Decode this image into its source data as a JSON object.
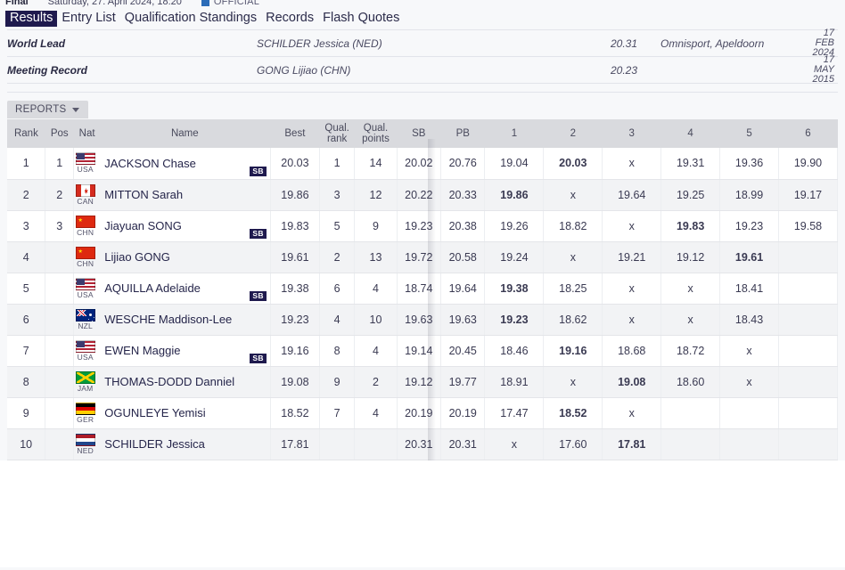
{
  "statusbar": {
    "round": "Final",
    "datetime": "Saturday, 27. April 2024, 18:20",
    "official_label": "OFFICIAL",
    "official_chip_color": "#2b6cb8"
  },
  "tabs": [
    {
      "label": "Results",
      "active": true
    },
    {
      "label": "Entry List",
      "active": false
    },
    {
      "label": "Qualification Standings",
      "active": false
    },
    {
      "label": "Records",
      "active": false
    },
    {
      "label": "Flash Quotes",
      "active": false
    }
  ],
  "records": [
    {
      "label": "World Lead",
      "athlete": "SCHILDER Jessica (NED)",
      "mark": "20.31",
      "venue": "Omnisport, Apeldoorn",
      "date_line1": "17 FEB",
      "date_line2": "2024"
    },
    {
      "label": "Meeting Record",
      "athlete": "GONG Lijiao (CHN)",
      "mark": "20.23",
      "venue": "",
      "date_line1": "17 MAY",
      "date_line2": "2015"
    }
  ],
  "reports": {
    "label": "REPORTS",
    "caret_icon": "chevron-down-icon"
  },
  "table": {
    "headers": {
      "rank": "Rank",
      "pos": "Pos",
      "nat": "Nat",
      "name": "Name",
      "best": "Best",
      "qual_rank_line1": "Qual.",
      "qual_rank_line2": "rank",
      "qual_points_line1": "Qual.",
      "qual_points_line2": "points",
      "sb": "SB",
      "pb": "PB",
      "attempts": [
        "1",
        "2",
        "3",
        "4",
        "5",
        "6"
      ]
    },
    "rows": [
      {
        "rank": "1",
        "pos": "1",
        "nat": "USA",
        "flag": "fl-usa",
        "name": "JACKSON Chase",
        "badge": "SB",
        "best": "20.03",
        "qual_rank": "1",
        "qual_points": "14",
        "sb": "20.02",
        "pb": "20.76",
        "attempts": [
          "19.04",
          "20.03",
          "x",
          "19.31",
          "19.36",
          "19.90"
        ],
        "best_attempt_index": 1
      },
      {
        "rank": "2",
        "pos": "2",
        "nat": "CAN",
        "flag": "fl-can",
        "name": "MITTON Sarah",
        "badge": "",
        "best": "19.86",
        "qual_rank": "3",
        "qual_points": "12",
        "sb": "20.22",
        "pb": "20.33",
        "attempts": [
          "19.86",
          "x",
          "19.64",
          "19.25",
          "18.99",
          "19.17"
        ],
        "best_attempt_index": 0
      },
      {
        "rank": "3",
        "pos": "3",
        "nat": "CHN",
        "flag": "fl-chn",
        "name": "Jiayuan SONG",
        "badge": "SB",
        "best": "19.83",
        "qual_rank": "5",
        "qual_points": "9",
        "sb": "19.23",
        "pb": "20.38",
        "attempts": [
          "19.26",
          "18.82",
          "x",
          "19.83",
          "19.23",
          "19.58"
        ],
        "best_attempt_index": 3
      },
      {
        "rank": "4",
        "pos": "",
        "nat": "CHN",
        "flag": "fl-chn",
        "name": "Lijiao GONG",
        "badge": "",
        "best": "19.61",
        "qual_rank": "2",
        "qual_points": "13",
        "sb": "19.72",
        "pb": "20.58",
        "attempts": [
          "19.24",
          "x",
          "19.21",
          "19.12",
          "19.61",
          ""
        ],
        "best_attempt_index": 4
      },
      {
        "rank": "5",
        "pos": "",
        "nat": "USA",
        "flag": "fl-usa",
        "name": "AQUILLA Adelaide",
        "badge": "SB",
        "best": "19.38",
        "qual_rank": "6",
        "qual_points": "4",
        "sb": "18.74",
        "pb": "19.64",
        "attempts": [
          "19.38",
          "18.25",
          "x",
          "x",
          "18.41",
          ""
        ],
        "best_attempt_index": 0
      },
      {
        "rank": "6",
        "pos": "",
        "nat": "NZL",
        "flag": "fl-nzl",
        "name": "WESCHE Maddison-Lee",
        "badge": "",
        "best": "19.23",
        "qual_rank": "4",
        "qual_points": "10",
        "sb": "19.63",
        "pb": "19.63",
        "attempts": [
          "19.23",
          "18.62",
          "x",
          "x",
          "18.43",
          ""
        ],
        "best_attempt_index": 0
      },
      {
        "rank": "7",
        "pos": "",
        "nat": "USA",
        "flag": "fl-usa",
        "name": "EWEN Maggie",
        "badge": "SB",
        "best": "19.16",
        "qual_rank": "8",
        "qual_points": "4",
        "sb": "19.14",
        "pb": "20.45",
        "attempts": [
          "18.46",
          "19.16",
          "18.68",
          "18.72",
          "x",
          ""
        ],
        "best_attempt_index": 1
      },
      {
        "rank": "8",
        "pos": "",
        "nat": "JAM",
        "flag": "fl-jam",
        "name": "THOMAS-DODD Danniel",
        "badge": "",
        "best": "19.08",
        "qual_rank": "9",
        "qual_points": "2",
        "sb": "19.12",
        "pb": "19.77",
        "attempts": [
          "18.91",
          "x",
          "19.08",
          "18.60",
          "x",
          ""
        ],
        "best_attempt_index": 2
      },
      {
        "rank": "9",
        "pos": "",
        "nat": "GER",
        "flag": "fl-ger",
        "name": "OGUNLEYE Yemisi",
        "badge": "",
        "best": "18.52",
        "qual_rank": "7",
        "qual_points": "4",
        "sb": "20.19",
        "pb": "20.19",
        "attempts": [
          "17.47",
          "18.52",
          "x",
          "",
          "",
          ""
        ],
        "best_attempt_index": 1
      },
      {
        "rank": "10",
        "pos": "",
        "nat": "NED",
        "flag": "fl-ned",
        "name": "SCHILDER Jessica",
        "badge": "",
        "best": "17.81",
        "qual_rank": "",
        "qual_points": "",
        "sb": "20.31",
        "pb": "20.31",
        "attempts": [
          "x",
          "17.60",
          "17.81",
          "",
          "",
          ""
        ],
        "best_attempt_index": 2
      }
    ]
  }
}
